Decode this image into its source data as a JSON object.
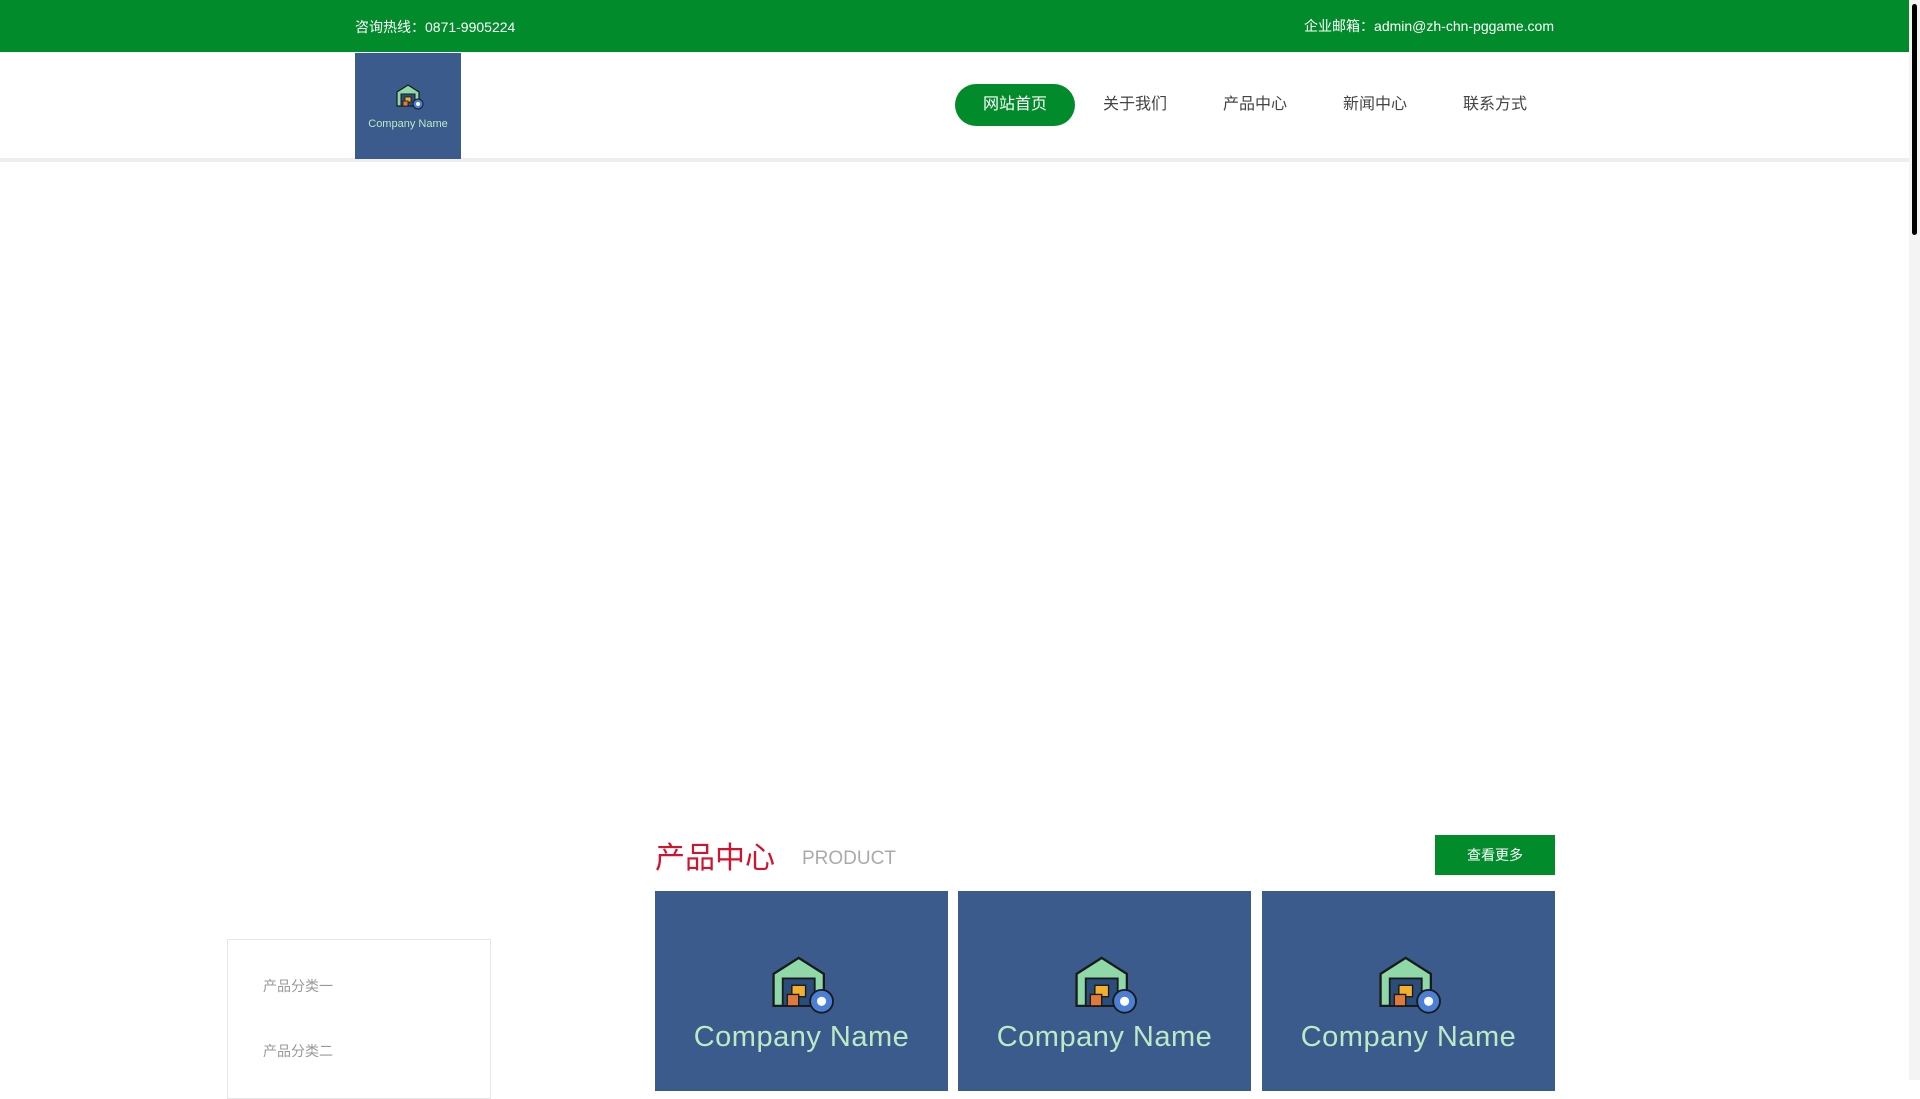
{
  "topbar": {
    "hotline": "咨询热线：0871-9905224",
    "email": "企业邮箱：admin@zh-chn-pggame.com"
  },
  "logo": {
    "text": "Company Name"
  },
  "nav": {
    "items": [
      {
        "label": "网站首页",
        "active": true
      },
      {
        "label": "关于我们",
        "active": false
      },
      {
        "label": "产品中心",
        "active": false
      },
      {
        "label": "新闻中心",
        "active": false
      },
      {
        "label": "联系方式",
        "active": false
      }
    ]
  },
  "sidebar": {
    "items": [
      {
        "label": "产品分类一"
      },
      {
        "label": "产品分类二"
      }
    ]
  },
  "products": {
    "title": "产品中心",
    "subtitle": "PRODUCT",
    "more_label": "查看更多",
    "cards": [
      {
        "text": "Company Name"
      },
      {
        "text": "Company Name"
      },
      {
        "text": "Company Name"
      }
    ]
  },
  "colors": {
    "brand_green": "#018b2b",
    "accent_red": "#d3122e",
    "card_blue": "#3a5b8c",
    "card_text": "#bfe8c4"
  },
  "icons": {
    "logo_mark": "warehouse-gear-icon"
  }
}
